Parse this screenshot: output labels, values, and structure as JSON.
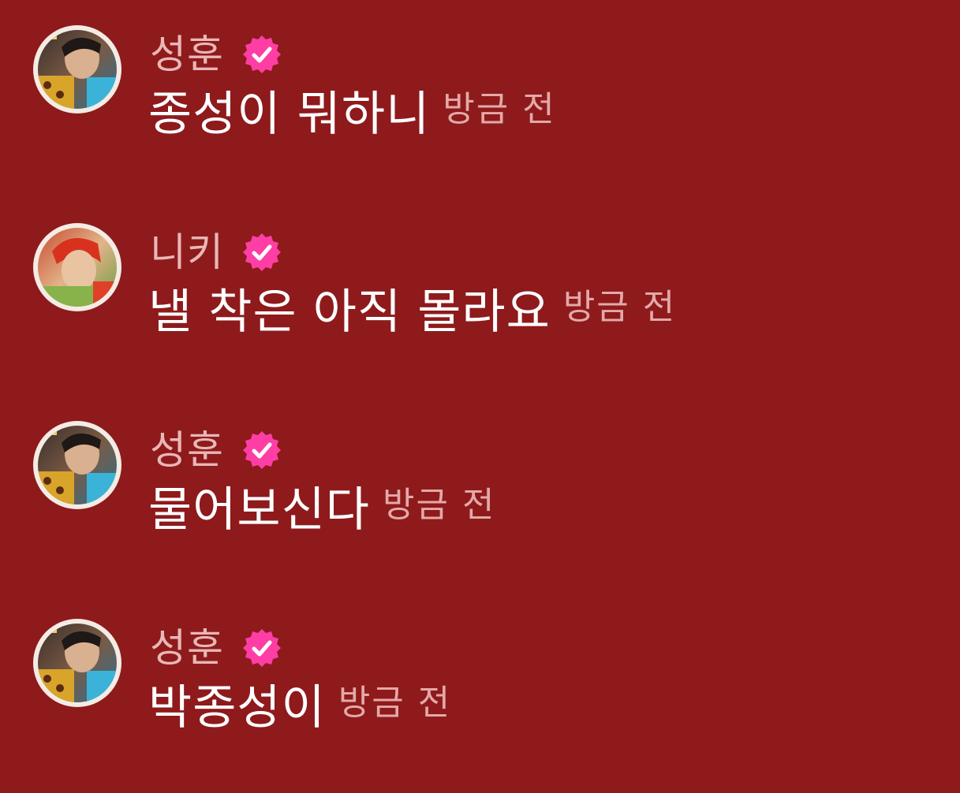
{
  "colors": {
    "background": "#8e1a1c",
    "username": "#e9b7b6",
    "message": "#ffffff",
    "timestamp": "#e3a9a8",
    "verified_badge": "#ff3ea5"
  },
  "comments": [
    {
      "username": "성훈",
      "verified": true,
      "avatar_icon": "avatar-sunghoon",
      "message": "종성이 뭐하니",
      "timestamp": "방금 전"
    },
    {
      "username": "니키",
      "verified": true,
      "avatar_icon": "avatar-niki",
      "message": "낼 착은 아직 몰라요",
      "timestamp": "방금 전"
    },
    {
      "username": "성훈",
      "verified": true,
      "avatar_icon": "avatar-sunghoon",
      "message": "물어보신다",
      "timestamp": "방금 전"
    },
    {
      "username": "성훈",
      "verified": true,
      "avatar_icon": "avatar-sunghoon",
      "message": "박종성이",
      "timestamp": "방금 전"
    }
  ]
}
